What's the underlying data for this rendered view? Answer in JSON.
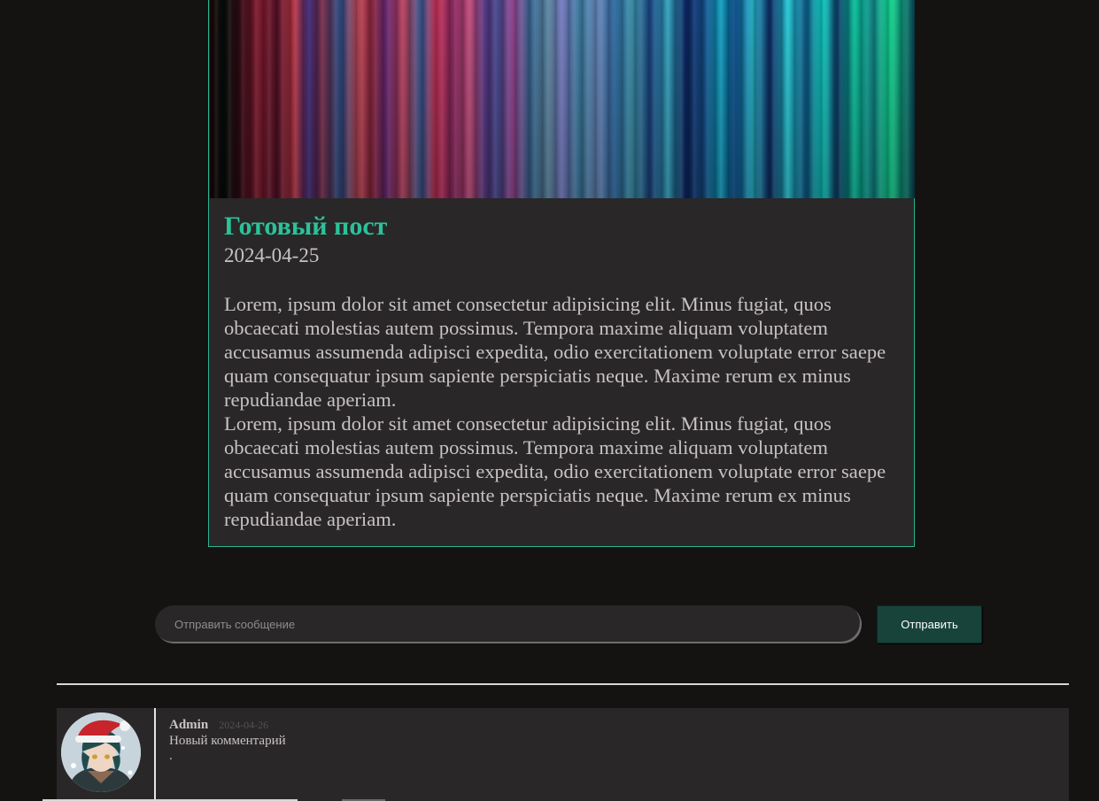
{
  "post": {
    "title": "Готовый пост",
    "date": "2024-04-25",
    "paragraphs": [
      "Lorem, ipsum dolor sit amet consectetur adipisicing elit. Minus fugiat, quos obcaecati molestias autem possimus. Tempora maxime aliquam voluptatem accusamus assumenda adipisci expedita, odio exercitationem voluptate error saepe quam consequatur ipsum sapiente perspiciatis neque. Maxime rerum ex minus repudiandae aperiam.",
      "Lorem, ipsum dolor sit amet consectetur adipisicing elit. Minus fugiat, quos obcaecati molestias autem possimus. Tempora maxime aliquam voluptatem accusamus assumenda adipisci expedita, odio exercitationem voluptate error saepe quam consequatur ipsum sapiente perspiciatis neque. Maxime rerum ex minus repudiandae aperiam."
    ]
  },
  "message_form": {
    "placeholder": "Отправить сообщение",
    "value": "",
    "send_label": "Отправить"
  },
  "comments": [
    {
      "author": "Admin",
      "date": "2024-04-26",
      "text": "Новый комментарий",
      "extra": "."
    }
  ],
  "colors": {
    "page_background": "#141312",
    "card_background": "#292728",
    "accent": "#2bc29a",
    "card_border": "#2bb58f",
    "button_background": "#17433b",
    "text": "#c9c2c2"
  }
}
